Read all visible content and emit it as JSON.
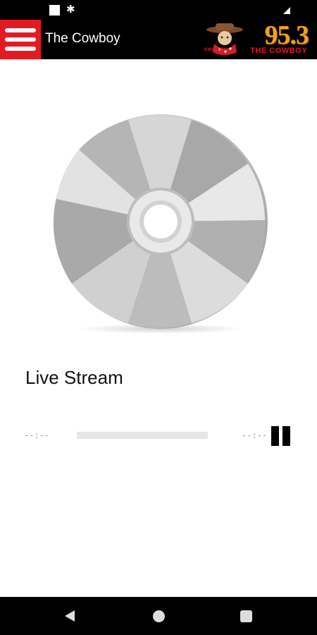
{
  "status_bar": {
    "icons": [
      "square-notification-icon",
      "gear-icon",
      "cell-signal-icon"
    ]
  },
  "app_bar": {
    "title": "The Cowboy",
    "menu_icon": "hamburger-menu-icon",
    "accent_color": "#e21a22"
  },
  "logo": {
    "frequency": "95.3",
    "tagline": "THE COWBOY",
    "callsign": "KWSW-FM"
  },
  "player": {
    "artwork_icon": "compact-disc-icon",
    "track_title": "Live Stream",
    "elapsed": "--:--",
    "duration": "--:--",
    "progress": 0,
    "control_icon": "pause-icon"
  },
  "nav_bar": {
    "icons": [
      "back-triangle-icon",
      "home-circle-icon",
      "recents-square-icon"
    ]
  }
}
